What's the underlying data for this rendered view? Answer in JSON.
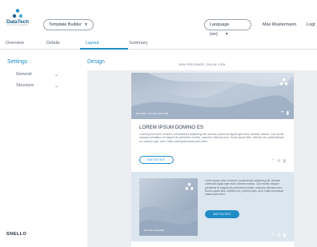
{
  "header": {
    "logo_text": "DataTech",
    "logo_tagline": "SOLUTIONS & SERVICES",
    "template_select": "Template Builder",
    "language_select": "Language (en)",
    "user_name": "Max Mustermann",
    "logout_label": "Logt"
  },
  "tabs": [
    {
      "label": "Overview",
      "active": false
    },
    {
      "label": "Details",
      "active": false
    },
    {
      "label": "Layout",
      "active": true
    },
    {
      "label": "Summary",
      "active": false
    }
  ],
  "sidebar": {
    "title": "Settings",
    "items": [
      {
        "label": "General"
      },
      {
        "label": "Structure"
      }
    ],
    "brand": "SNELLO"
  },
  "design": {
    "title": "Design",
    "preview_label": "NEW PREVIEWER | ONLINE VIEW",
    "hero_caption": "HEADER PLACE HOLDER",
    "headline": "LOREM IPSUM DOMINO ES",
    "body": "Lorem ipsum dolor sit amet, consectetuer adipiscing elit. Aenean commodo ligula eget dolor. Aenean massa. Cum sociis natoque penatibus et magnis dis parturient montes, nascetur ridiculus mus. Donec quam felis, ultricies nec, pellentesque eu, pretium quis, sem. Nulla consequat massa quis enim.",
    "button_outline": "BUTTON TEXT",
    "block2_text": "Lorem ipsum dolor sit amet, consectetuer adipiscing elit. Aenean commodo ligula eget dolor. Aenean massa. Cum sociis natoque penatibus et magnis dis parturient montes, nascetur ridiculus mus. Donec quam felis, ultricies nec, pretium quis, sem. Nulla consequat massa quis enim.",
    "button_solid": "BUTTON TEXT",
    "thumb_caption": "PLACE HOLDER"
  },
  "colors": {
    "accent": "#1f8cc6",
    "block_bg": "#dce6ef",
    "canvas_bg": "#eceef1"
  }
}
